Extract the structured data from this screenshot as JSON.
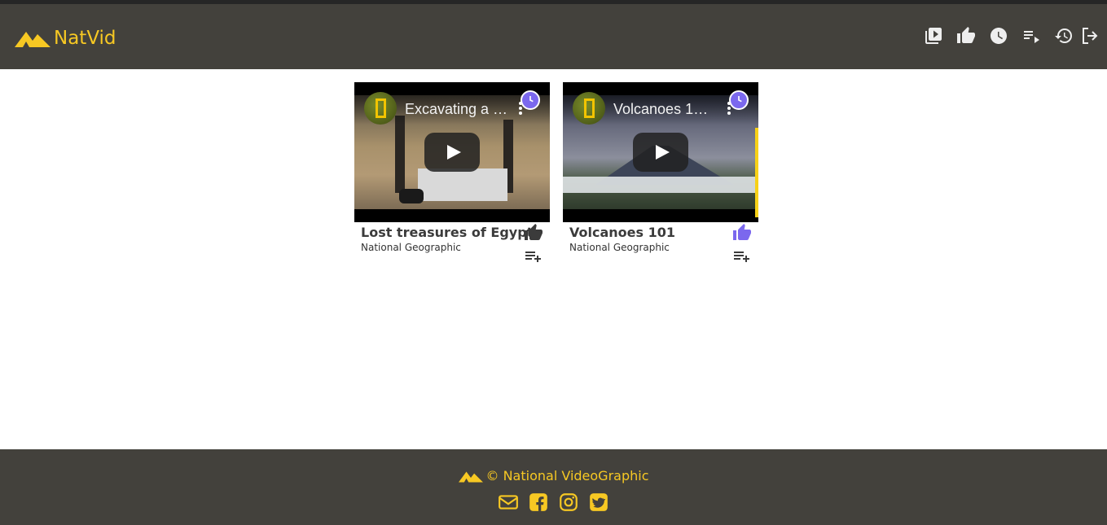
{
  "brand": {
    "name": "NatVid"
  },
  "nav": {
    "icons": [
      "video-library-icon",
      "thumb-up-icon",
      "clock-icon",
      "playlist-icon",
      "history-icon",
      "logout-icon"
    ]
  },
  "videos": [
    {
      "card_title": "Lost treasures of Egypt",
      "channel": "National Geographic",
      "overlay_title": "Excavating a …",
      "liked": false
    },
    {
      "card_title": "Volcanoes 101",
      "channel": "National Geographic",
      "overlay_title": "Volcanoes 1…",
      "liked": true
    }
  ],
  "footer": {
    "text": "© National VideoGraphic",
    "socials": [
      "mail-icon",
      "facebook-icon",
      "instagram-icon",
      "twitter-icon"
    ]
  },
  "colors": {
    "header_bg": "#43413c",
    "accent": "#f7c823",
    "liked": "#7b68ee",
    "icon_light": "#eeeeee",
    "icon_dark": "#3b3b3b"
  }
}
